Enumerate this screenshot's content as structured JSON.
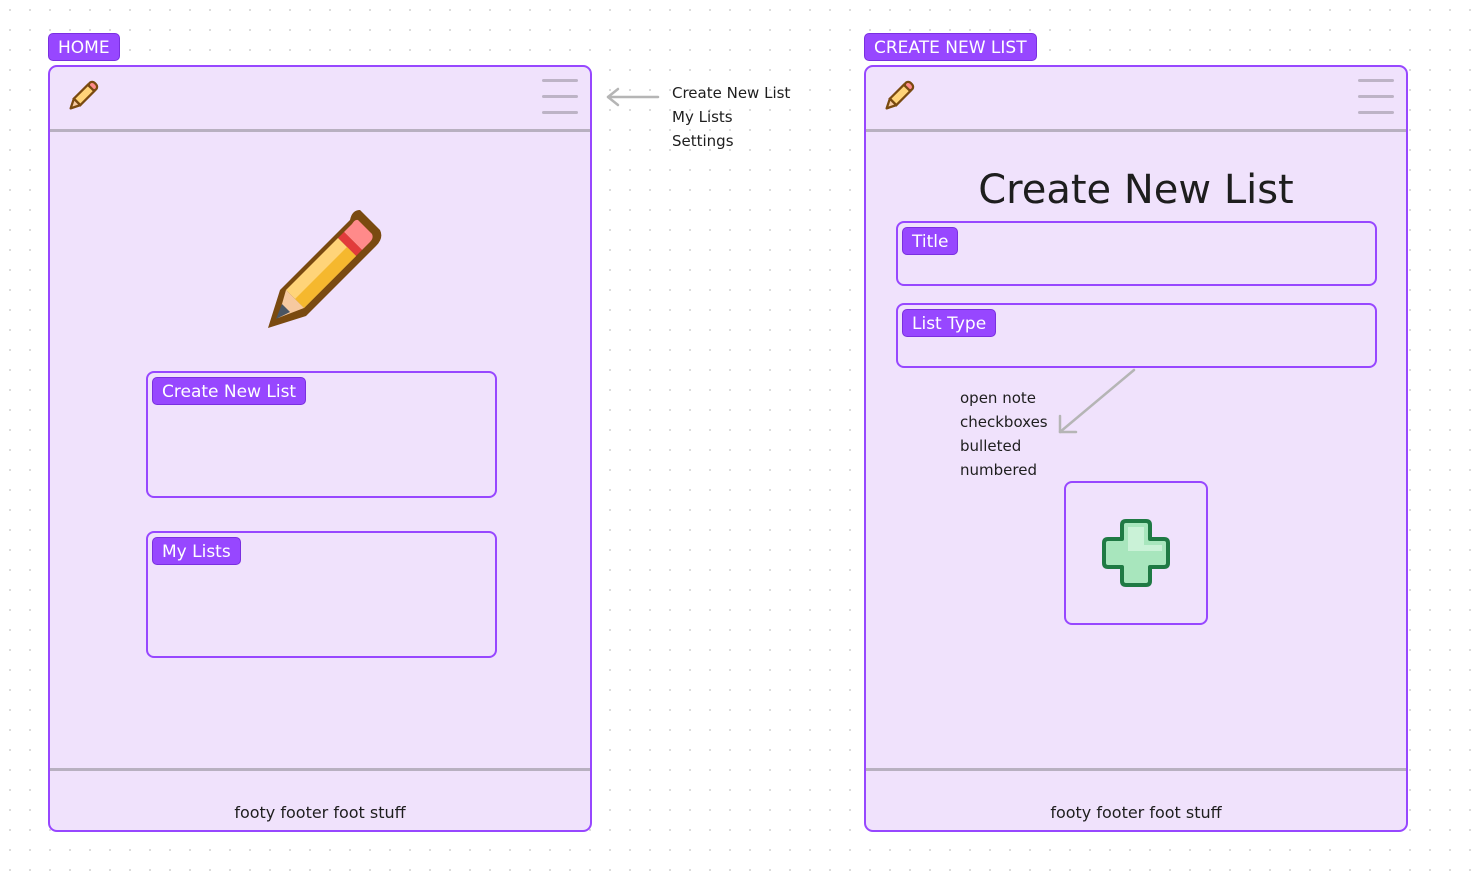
{
  "home": {
    "frame_label": "HOME",
    "buttons": [
      "Create New List",
      "My Lists"
    ],
    "footer": "footy footer foot stuff"
  },
  "menu_notes": {
    "items": [
      "Create New List",
      "My Lists",
      "Settings"
    ]
  },
  "create": {
    "frame_label": "CREATE NEW LIST",
    "heading": "Create New List",
    "fields": [
      "Title",
      "List Type"
    ],
    "list_type_options": [
      "open note",
      "checkboxes",
      "bulleted",
      "numbered"
    ],
    "footer": "footy footer foot stuff"
  },
  "icons": {
    "logo": "pencil-icon",
    "menu": "hamburger-menu-icon",
    "hero": "pencil-icon",
    "add": "plus-icon",
    "arrow": "arrow-icon"
  },
  "colors": {
    "accent": "#9747ff",
    "phone_bg": "#f0e2fc",
    "divider": "#b8b0c0",
    "plus_green": "#1f8a4c"
  }
}
